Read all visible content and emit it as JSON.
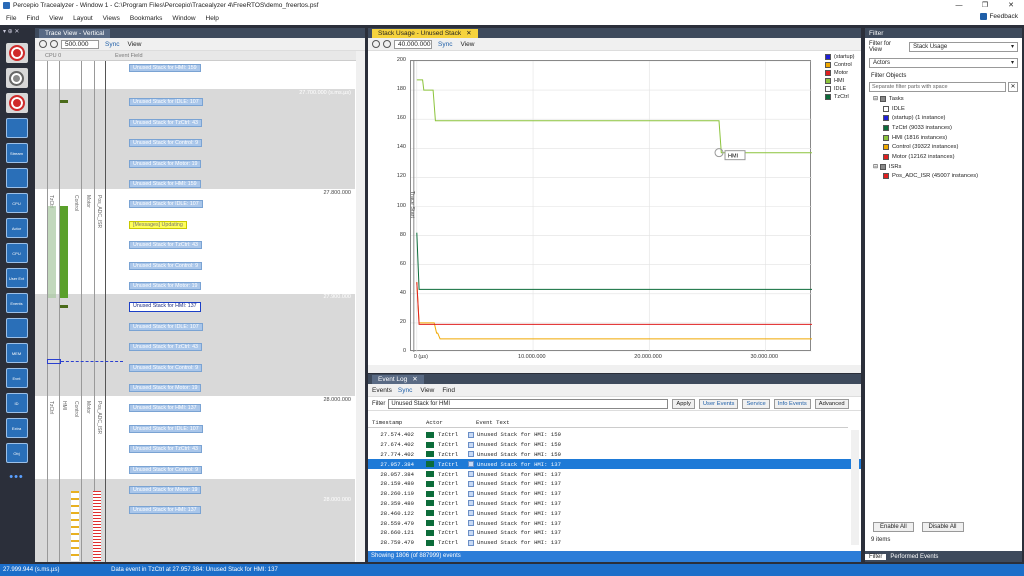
{
  "window": {
    "title": "Percepio Tracealyzer - Window 1 - C:\\Program Files\\Percepio\\Tracealyzer 4\\FreeRTOS\\demo_freertos.psf",
    "controls": [
      "—",
      "❐",
      "✕"
    ]
  },
  "menu": [
    "File",
    "Find",
    "View",
    "Layout",
    "Views",
    "Bookmarks",
    "Window",
    "Help"
  ],
  "feedback_label": "Feedback",
  "left_toolbar": {
    "pin": "▾ ⊕ ✕",
    "icons": [
      "record-icon",
      "stop-icon",
      "snapshot-icon",
      "dashboard-icon",
      "stream-icon",
      "trace-icon",
      "cpu-load-icon",
      "actor-icon",
      "cpu-icon",
      "user-events-icon",
      "events-icon",
      "intervals-icon",
      "memory-icon",
      "extra-icon",
      "id-icon",
      "extra2-icon",
      "objects-icon"
    ],
    "icon_labels": [
      "",
      "",
      "",
      "",
      "Stream",
      "",
      "CPU",
      "Actor",
      "CPU",
      "User Evt",
      "Events",
      "",
      "MEM",
      "Evnt",
      "ID",
      "Extra",
      "Obj"
    ],
    "more": "•••"
  },
  "trace_view": {
    "tab": "Trace View - Vertical",
    "zoom": "500.000",
    "sync": "Sync",
    "view": "View",
    "col_cpu": "CPU 0",
    "col_event": "Event Field",
    "time_labels": [
      "27.700.000 (s.ms.µs)",
      "27.800.000",
      "27.900.000",
      "28.000.000",
      "28.000.000"
    ],
    "lanes": [
      "TzCtrl",
      "Control",
      "Motor",
      "Pos_ADC_ISR",
      "TzCtrl",
      "HMI",
      "Control",
      "Motor",
      "Pos_ADC_ISR"
    ],
    "events": [
      "Unused Stack for HMI: 159",
      "Unused Stack for IDLE: 107",
      "Unused Stack for TzCtrl: 43",
      "Unused Stack for Control: 9",
      "Unused Stack for Motor: 19",
      "Unused Stack for HMI: 159",
      "Unused Stack for IDLE: 107",
      "[Messages] Updating",
      "Unused Stack for TzCtrl: 43",
      "Unused Stack for Control: 9",
      "Unused Stack for Motor: 19",
      "Unused Stack for HMI: 137",
      "Unused Stack for IDLE: 107",
      "Unused Stack for TzCtrl: 43",
      "Unused Stack for Control: 9",
      "Unused Stack for Motor: 19",
      "Unused Stack for HMI: 137",
      "Unused Stack for IDLE: 107",
      "Unused Stack for TzCtrl: 43",
      "Unused Stack for Control: 9",
      "Unused Stack for Motor: 19",
      "Unused Stack for HMI: 137"
    ]
  },
  "stack_usage": {
    "tab": "Stack Usage - Unused Stack",
    "zoom": "40.000.000",
    "sync": "Sync",
    "view": "View",
    "trace_start": "Trace Start",
    "hmi_marker": "HMI"
  },
  "chart_data": {
    "type": "line",
    "title": "Stack Usage - Unused Stack",
    "ylim": [
      0,
      200
    ],
    "yticks": [
      0,
      20,
      40,
      60,
      80,
      100,
      120,
      140,
      160,
      180,
      200
    ],
    "xticks": [
      "0 (µs)",
      "10.000.000",
      "20.000.000",
      "30.000.000"
    ],
    "xlim": [
      -500000,
      34000000
    ],
    "series": [
      {
        "name": "(startup)",
        "color": "#1f1fd6",
        "points": []
      },
      {
        "name": "Control",
        "color": "#f0a800",
        "points": [
          [
            0,
            48
          ],
          [
            200000,
            20
          ],
          [
            1500000,
            20
          ],
          [
            1700000,
            13
          ],
          [
            1800000,
            13
          ],
          [
            2000000,
            9
          ],
          [
            34000000,
            9
          ]
        ]
      },
      {
        "name": "Motor",
        "color": "#e02020",
        "points": [
          [
            0,
            48
          ],
          [
            200000,
            19
          ],
          [
            34000000,
            19
          ]
        ]
      },
      {
        "name": "HMI",
        "color": "#8cc43c",
        "points": [
          [
            0,
            187
          ],
          [
            500000,
            187
          ],
          [
            600000,
            180
          ],
          [
            1400000,
            180
          ],
          [
            1600000,
            159
          ],
          [
            26000000,
            159
          ],
          [
            26200000,
            137
          ],
          [
            34000000,
            137
          ]
        ]
      },
      {
        "name": "IDLE",
        "color": "#ffffff",
        "points": []
      },
      {
        "name": "TzCtrl",
        "color": "#0c6c3a",
        "points": [
          [
            0,
            82
          ],
          [
            200000,
            43
          ],
          [
            34000000,
            43
          ]
        ]
      }
    ]
  },
  "event_log": {
    "tab": "Event Log",
    "menu": [
      "Events",
      "Sync",
      "View",
      "Find"
    ],
    "filter_label": "Filter",
    "filter_value": "Unused Stack for HMI",
    "buttons": [
      "Apply",
      "User Events",
      "Service",
      "Info Events",
      "Advanced"
    ],
    "columns": [
      "Timestamp",
      "Actor",
      "Event Text"
    ],
    "rows": [
      {
        "ts": "27.574.402",
        "actor": "TzCtrl",
        "text": "Unused Stack for HMI: 159"
      },
      {
        "ts": "27.674.402",
        "actor": "TzCtrl",
        "text": "Unused Stack for HMI: 159"
      },
      {
        "ts": "27.774.402",
        "actor": "TzCtrl",
        "text": "Unused Stack for HMI: 159"
      },
      {
        "ts": "27.957.384",
        "actor": "TzCtrl",
        "text": "Unused Stack for HMI: 137"
      },
      {
        "ts": "28.057.384",
        "actor": "TzCtrl",
        "text": "Unused Stack for HMI: 137"
      },
      {
        "ts": "28.159.480",
        "actor": "TzCtrl",
        "text": "Unused Stack for HMI: 137"
      },
      {
        "ts": "28.260.119",
        "actor": "TzCtrl",
        "text": "Unused Stack for HMI: 137"
      },
      {
        "ts": "28.359.480",
        "actor": "TzCtrl",
        "text": "Unused Stack for HMI: 137"
      },
      {
        "ts": "28.460.122",
        "actor": "TzCtrl",
        "text": "Unused Stack for HMI: 137"
      },
      {
        "ts": "28.559.479",
        "actor": "TzCtrl",
        "text": "Unused Stack for HMI: 137"
      },
      {
        "ts": "28.660.121",
        "actor": "TzCtrl",
        "text": "Unused Stack for HMI: 137"
      },
      {
        "ts": "28.759.479",
        "actor": "TzCtrl",
        "text": "Unused Stack for HMI: 137"
      }
    ],
    "selected_index": 3,
    "status": "Showing 1806 (of 887999) events"
  },
  "filter_panel": {
    "title": "Filter",
    "filter_for_view_label": "Filter for View",
    "filter_for_view_value": "Stack Usage",
    "actors_value": "Actors",
    "filter_objects_label": "Filter Objects",
    "search_placeholder": "Separate filter parts with space",
    "tree": [
      {
        "label": "Tasks",
        "color": "#888888",
        "level": 0
      },
      {
        "label": "IDLE",
        "color": "#ffffff",
        "level": 1
      },
      {
        "label": "(startup) (1 instance)",
        "color": "#1f1fd6",
        "level": 1
      },
      {
        "label": "TzCtrl (9033 instances)",
        "color": "#0c6c3a",
        "level": 1
      },
      {
        "label": "HMI (1816 instances)",
        "color": "#8cc43c",
        "level": 1
      },
      {
        "label": "Control (39322 instances)",
        "color": "#f0a800",
        "level": 1
      },
      {
        "label": "Motor (12162 instances)",
        "color": "#e02020",
        "level": 1
      },
      {
        "label": "ISRs",
        "color": "#888888",
        "level": 0
      },
      {
        "label": "Pos_ADC_ISR (45007 instances)",
        "color": "#e02020",
        "level": 1
      }
    ],
    "enable_all": "Enable All",
    "disable_all": "Disable All",
    "items_count": "9 items",
    "tabs": [
      "Filter",
      "Performed Events"
    ]
  },
  "statusbar": {
    "time": "27.999.944 (s.ms.µs)",
    "message": "Data event in TzCtrl at 27.957.384: Unused Stack for HMI: 137"
  }
}
